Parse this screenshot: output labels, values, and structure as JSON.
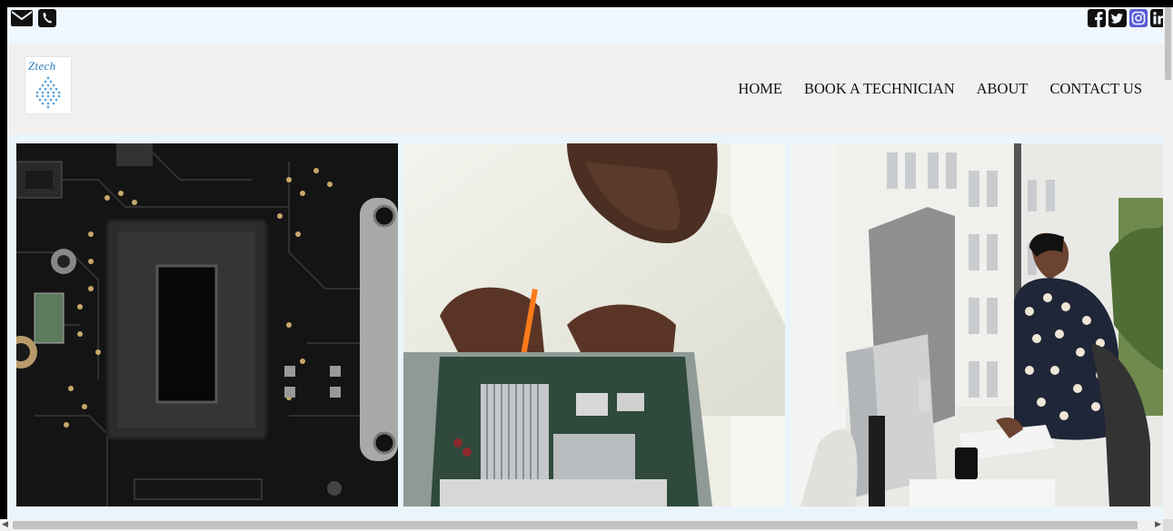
{
  "topbar": {
    "contact_icons": [
      "envelope-icon",
      "phone-icon"
    ],
    "social_icons": [
      "facebook-icon",
      "twitter-icon",
      "instagram-icon",
      "linkedin-icon"
    ]
  },
  "header": {
    "logo_text": "Ztech",
    "nav": [
      {
        "label": "HOME"
      },
      {
        "label": "BOOK A TECHNICIAN"
      },
      {
        "label": "ABOUT"
      },
      {
        "label": "CONTACT US"
      }
    ]
  },
  "gallery": {
    "images": [
      {
        "subject": "circuit-board-photo"
      },
      {
        "subject": "technician-repairing-computer-photo"
      },
      {
        "subject": "woman-at-computer-photo"
      }
    ]
  },
  "colors": {
    "topbar_bg": "#f0f8ff",
    "header_bg": "#f0f0f0",
    "instagram": "#5b5bd6",
    "icon_dark": "#111111"
  }
}
